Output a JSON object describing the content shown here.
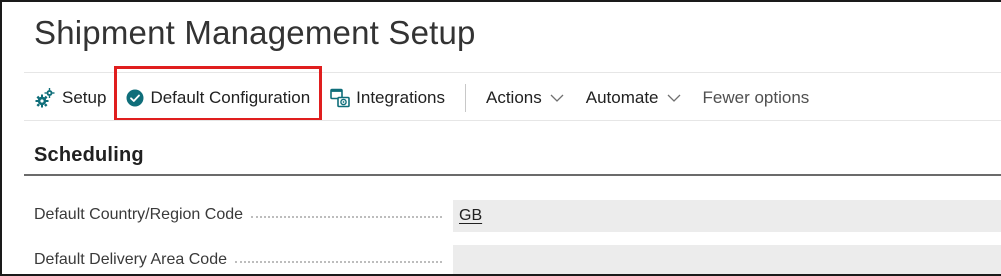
{
  "page": {
    "title": "Shipment Management Setup"
  },
  "action_bar": {
    "items": [
      {
        "label": "Setup",
        "icon": "setup-gears-icon"
      },
      {
        "label": "Default Configuration",
        "icon": "check-circle-icon"
      },
      {
        "label": "Integrations",
        "icon": "integrations-icon"
      },
      {
        "label": "Actions",
        "icon": "chevron-down-icon"
      },
      {
        "label": "Automate",
        "icon": "chevron-down-icon"
      },
      {
        "label": "Fewer options"
      }
    ]
  },
  "section": {
    "title": "Scheduling",
    "fields": [
      {
        "label": "Default Country/Region Code",
        "value": "GB"
      },
      {
        "label": "Default Delivery Area Code",
        "value": ""
      }
    ]
  },
  "colors": {
    "accent_teal": "#0f6e7a",
    "highlight_red": "#e01e1e",
    "field_background": "#ececec"
  }
}
